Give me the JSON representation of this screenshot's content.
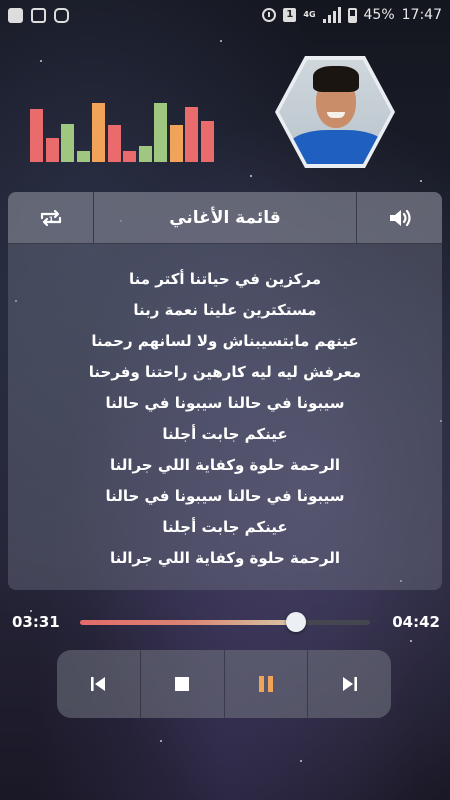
{
  "status_bar": {
    "sim_label": "1",
    "network": "4G",
    "battery": "45%",
    "time": "17:47"
  },
  "equalizer": {
    "levels": [
      0.83,
      0.38,
      0.6,
      0.17,
      0.92,
      0.58,
      0.17,
      0.25,
      0.92,
      0.58,
      0.86,
      0.64
    ],
    "colors": [
      "#e96b6b",
      "#e96b6b",
      "#9fc77f",
      "#9fc77f",
      "#f2a35a",
      "#e96b6b",
      "#e96b6b",
      "#9fc77f",
      "#9fc77f",
      "#f2a35a",
      "#e96b6b",
      "#e96b6b"
    ]
  },
  "header": {
    "title": "قائمة الأغاني",
    "left_icon": "repeat-one-icon",
    "right_icon": "volume-icon"
  },
  "lyrics": [
    "مركزين في حياتنا أكتر منا",
    "مستكترين علينا نعمة ربنا",
    "عينهم مابتسيبناش ولا لسانهم رحمنا",
    "معرفش ليه ليه كارهين راحتنا وفرحنا",
    "سيبونا في حالنا سيبونا في حالنا",
    "عينكم جابت أجلنا",
    "الرحمة حلوة وكفاية اللي جرالنا",
    "سيبونا في حالنا سيبونا في حالنا",
    "عينكم جابت أجلنا",
    "الرحمة حلوة وكفاية اللي جرالنا"
  ],
  "player": {
    "elapsed": "03:31",
    "total": "04:42",
    "progress": 0.745
  },
  "controls": [
    {
      "name": "previous-button",
      "icon": "skip-previous-icon"
    },
    {
      "name": "stop-button",
      "icon": "stop-icon"
    },
    {
      "name": "pause-button",
      "icon": "pause-icon"
    },
    {
      "name": "next-button",
      "icon": "skip-next-icon"
    }
  ],
  "colors": {
    "accent": "#f2a35a",
    "progress_start": "#e46a6a",
    "progress_end": "#d8c9a4"
  }
}
